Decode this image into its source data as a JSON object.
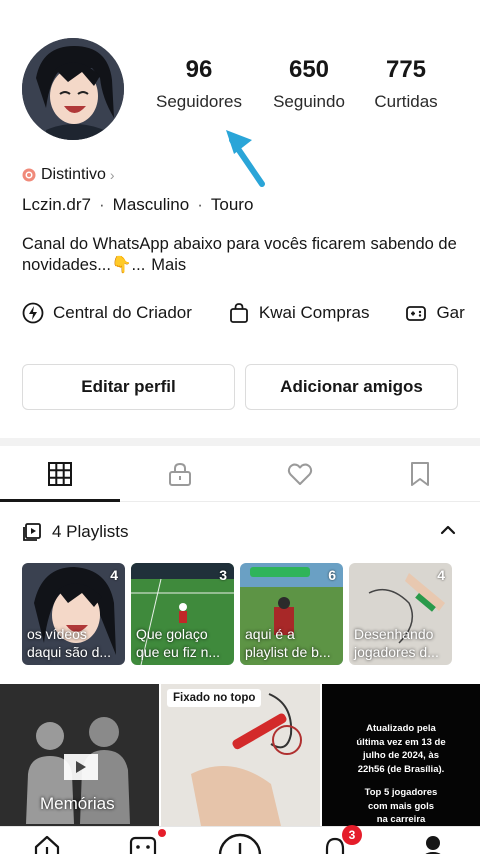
{
  "profile": {
    "stats": [
      {
        "value": "96",
        "label": "Seguidores"
      },
      {
        "value": "650",
        "label": "Seguindo"
      },
      {
        "value": "775",
        "label": "Curtidas"
      }
    ],
    "badge": "Distintivo",
    "username": "Lczin.dr7",
    "gender": "Masculino",
    "sign": "Touro",
    "bio": "Canal do WhatsApp abaixo para vocês ficarem sabendo de novidades...👇...",
    "bio_more": "Mais"
  },
  "links": [
    {
      "label": "Central do Criador",
      "icon": "bolt-icon"
    },
    {
      "label": "Kwai Compras",
      "icon": "bag-icon"
    },
    {
      "label": "Gar",
      "icon": "gamepad-icon"
    }
  ],
  "buttons": {
    "edit": "Editar perfil",
    "add": "Adicionar amigos"
  },
  "tabs": [
    "grid-icon",
    "lock-icon",
    "heart-icon",
    "bookmark-icon"
  ],
  "playlists": {
    "title": "4 Playlists",
    "items": [
      {
        "count": "4",
        "caption": "os vídeos daqui são d..."
      },
      {
        "count": "3",
        "caption": "Que golaço que eu fiz n..."
      },
      {
        "count": "6",
        "caption": "aqui é a playlist de b..."
      },
      {
        "count": "4",
        "caption": "Desenhando jogadores d..."
      }
    ]
  },
  "grid": {
    "memories_label": "Memórias",
    "pinned_label": "Fixado no topo",
    "update_text_1": "Atualizado pela última vez em 13 de julho de 2024, às 22h56 (de Brasília).",
    "update_text_2": "Top 5 jogadores com mais gols na carreira"
  },
  "nav": {
    "notification_count": "3"
  },
  "colors": {
    "accent_red": "#e51d2a",
    "arrow_blue": "#2aa5d8"
  }
}
